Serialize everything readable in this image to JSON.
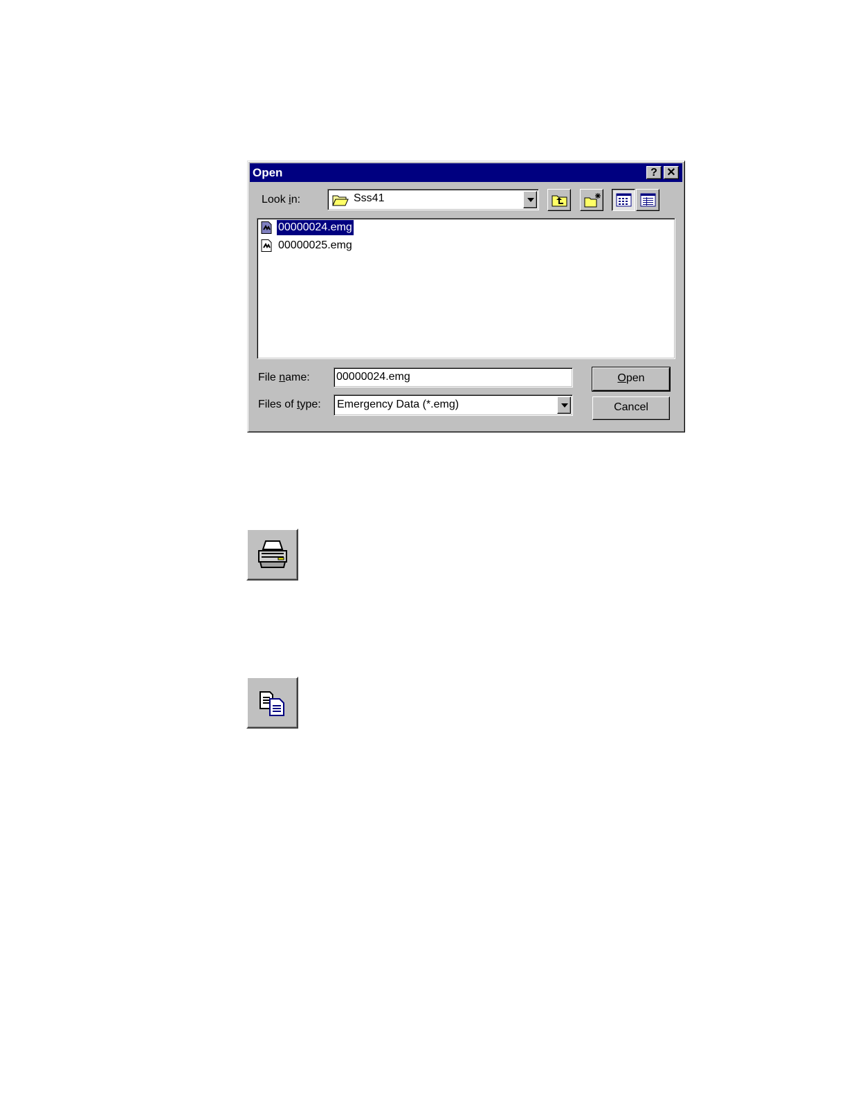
{
  "dialog": {
    "title": "Open",
    "help_label": "?",
    "close_label": "✕",
    "look_in": {
      "label_pre": "Look ",
      "label_u": "i",
      "label_post": "n:",
      "value": "Sss41",
      "folder_icon": "folder-icon"
    },
    "toolbar": {
      "up_folder_icon": "up-one-level-icon",
      "new_folder_icon": "new-folder-icon",
      "list_view_icon": "list-view-icon",
      "details_view_icon": "details-view-icon"
    },
    "files": [
      {
        "name": "00000024.emg",
        "selected": true,
        "icon": "emg-file-icon"
      },
      {
        "name": "00000025.emg",
        "selected": false,
        "icon": "emg-file-icon"
      }
    ],
    "file_name": {
      "label_pre": "File ",
      "label_u": "n",
      "label_post": "ame:",
      "value": "00000024.emg"
    },
    "file_type": {
      "label_pre": "Files of ",
      "label_u": "t",
      "label_post": "ype:",
      "value": "Emergency Data (*.emg)"
    },
    "open_button": {
      "u": "O",
      "rest": "pen"
    },
    "cancel_button": "Cancel"
  },
  "standalone_buttons": [
    {
      "icon": "printer-icon"
    },
    {
      "icon": "copy-icon"
    }
  ]
}
